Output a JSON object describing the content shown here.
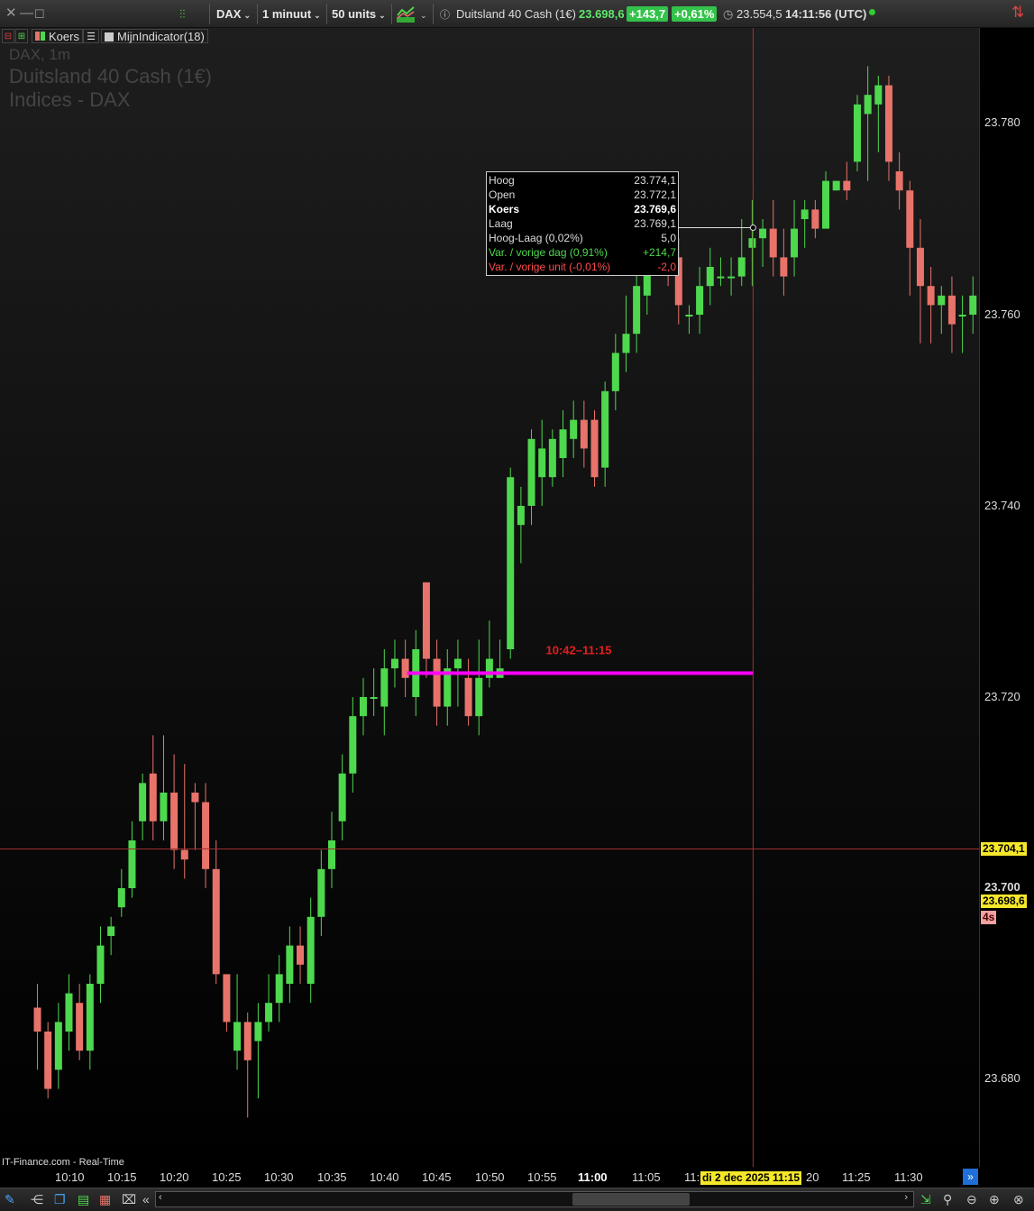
{
  "toolbar": {
    "instrument": "DAX",
    "timeframe": "1 minuut",
    "units": "50 units",
    "instrument_name": "Duitsland 40 Cash (1€)",
    "price": "23.698,6",
    "change_abs": "+143,7",
    "change_pct": "+0,61%",
    "prev_close": "23.554,5",
    "time": "14:11:56 (UTC)"
  },
  "legend": {
    "koers": "Koers",
    "indicator": "MijnIndicator(18)"
  },
  "watermark": {
    "line1": "DAX, 1m",
    "line2": "Duitsland 40 Cash (1€)",
    "line3": "Indices - DAX"
  },
  "tooltip": [
    {
      "label": "Hoog",
      "value": "23.774,1",
      "style": "normal"
    },
    {
      "label": "Open",
      "value": "23.772,1",
      "style": "normal"
    },
    {
      "label": "Koers",
      "value": "23.769,6",
      "style": "bold"
    },
    {
      "label": "Laag",
      "value": "23.769,1",
      "style": "normal"
    },
    {
      "label": "Hoog-Laag (0,02%)",
      "value": "5,0",
      "style": "normal"
    },
    {
      "label": "Var. / vorige dag (0,91%)",
      "value": "+214,7",
      "style": "green"
    },
    {
      "label": "Var. / vorige unit (-0,01%)",
      "value": "-2,0",
      "style": "red"
    }
  ],
  "price_axis": {
    "ticks": [
      "23.780",
      "23.760",
      "23.740",
      "23.720",
      "23.700",
      "23.680"
    ],
    "crosshair_price": "23.704,1",
    "last_price": "23.698,6",
    "countdown": "4s"
  },
  "time_axis": {
    "labels": [
      "10:10",
      "10:15",
      "10:20",
      "10:25",
      "10:30",
      "10:35",
      "10:40",
      "10:45",
      "10:50",
      "10:55",
      "11:00",
      "11:05",
      "11:",
      "20",
      "11:25",
      "11:30"
    ],
    "crosshair_time": "di 2 dec 2025 11:15"
  },
  "range_label": "10:42–11:15",
  "source": "IT-Finance.com - Real-Time",
  "colors": {
    "up": "#4ed84e",
    "down": "#e8736a",
    "magenta": "#ff00ff",
    "crosshair": "#a03030",
    "tag_yellow": "#f5e72a",
    "tag_pink": "#f4a0a0"
  },
  "chart_data": {
    "type": "candlestick",
    "title": "Duitsland 40 Cash (1€)",
    "xlabel": "",
    "ylabel": "",
    "ylim": [
      23670,
      23790
    ],
    "range_level": 23722.5,
    "range_start": "10:42",
    "range_end": "11:15",
    "candles": [
      [
        "10:07",
        23687.5,
        23685,
        23690,
        23681
      ],
      [
        "10:08",
        23685,
        23679,
        23686,
        23678
      ],
      [
        "10:09",
        23681,
        23686,
        23688,
        23679
      ],
      [
        "10:10",
        23685,
        23689,
        23691,
        23683
      ],
      [
        "10:11",
        23688,
        23683,
        23690,
        23682
      ],
      [
        "10:12",
        23683,
        23690,
        23691,
        23681
      ],
      [
        "10:13",
        23690,
        23694,
        23696,
        23688
      ],
      [
        "10:14",
        23695,
        23696,
        23697,
        23693
      ],
      [
        "10:15",
        23698,
        23700,
        23702,
        23697
      ],
      [
        "10:16",
        23700,
        23705,
        23707,
        23699
      ],
      [
        "10:17",
        23707,
        23711,
        23712,
        23705
      ],
      [
        "10:18",
        23712,
        23707,
        23716,
        23705
      ],
      [
        "10:19",
        23707,
        23710,
        23716,
        23705
      ],
      [
        "10:20",
        23710,
        23704,
        23714,
        23702
      ],
      [
        "10:21",
        23704,
        23703,
        23713,
        23701
      ],
      [
        "10:22",
        23710,
        23709,
        23711,
        23704
      ],
      [
        "10:23",
        23709,
        23702,
        23711,
        23700
      ],
      [
        "10:24",
        23702,
        23691,
        23705,
        23690
      ],
      [
        "10:25",
        23691,
        23686,
        23691,
        23685
      ],
      [
        "10:26",
        23683,
        23686,
        23691,
        23681
      ],
      [
        "10:27",
        23686,
        23682,
        23687,
        23676
      ],
      [
        "10:28",
        23684,
        23686,
        23688,
        23678
      ],
      [
        "10:29",
        23686,
        23688,
        23691,
        23685
      ],
      [
        "10:30",
        23688,
        23691,
        23693,
        23686
      ],
      [
        "10:31",
        23690,
        23694,
        23696,
        23688
      ],
      [
        "10:32",
        23694,
        23692,
        23696,
        23690
      ],
      [
        "10:33",
        23690,
        23697,
        23699,
        23688
      ],
      [
        "10:34",
        23697,
        23702,
        23704,
        23695
      ],
      [
        "10:35",
        23702,
        23705,
        23708,
        23700
      ],
      [
        "10:36",
        23707,
        23712,
        23714,
        23705
      ],
      [
        "10:37",
        23712,
        23718,
        23720,
        23710
      ],
      [
        "10:38",
        23718,
        23720,
        23722,
        23716
      ],
      [
        "10:39",
        23720,
        23720,
        23723,
        23718
      ],
      [
        "10:40",
        23719,
        23723,
        23725,
        23716
      ],
      [
        "10:41",
        23723,
        23724,
        23726,
        23721
      ],
      [
        "10:42",
        23724,
        23722,
        23726,
        23720
      ],
      [
        "10:43",
        23720,
        23725,
        23727,
        23718
      ],
      [
        "10:44",
        23732,
        23724,
        23732,
        23722
      ],
      [
        "10:45",
        23724,
        23719,
        23726,
        23717
      ],
      [
        "10:46",
        23719,
        23723,
        23725,
        23717
      ],
      [
        "10:47",
        23723,
        23724,
        23726,
        23719
      ],
      [
        "10:48",
        23722,
        23718,
        23724,
        23717
      ],
      [
        "10:49",
        23718,
        23722,
        23726,
        23716
      ],
      [
        "10:50",
        23722,
        23724,
        23728,
        23721
      ],
      [
        "10:51",
        23722,
        23723,
        23726,
        23722
      ],
      [
        "10:52",
        23725,
        23743,
        23744,
        23724
      ],
      [
        "10:53",
        23738,
        23740,
        23742,
        23734
      ],
      [
        "10:54",
        23740,
        23747,
        23748,
        23738
      ],
      [
        "10:55",
        23743,
        23746,
        23749,
        23740
      ],
      [
        "10:56",
        23743,
        23747,
        23748,
        23742
      ],
      [
        "10:57",
        23745,
        23748,
        23750,
        23743
      ],
      [
        "10:58",
        23747,
        23749,
        23751,
        23745
      ],
      [
        "10:59",
        23749,
        23746,
        23751,
        23744
      ],
      [
        "11:00",
        23749,
        23743,
        23750,
        23742
      ],
      [
        "11:01",
        23744,
        23752,
        23753,
        23742
      ],
      [
        "11:02",
        23752,
        23756,
        23758,
        23750
      ],
      [
        "11:03",
        23756,
        23758,
        23762,
        23754
      ],
      [
        "11:04",
        23758,
        23763,
        23765,
        23756
      ],
      [
        "11:05",
        23762,
        23770,
        23772,
        23760
      ],
      [
        "11:06",
        23770,
        23769,
        23774,
        23766
      ],
      [
        "11:07",
        23769,
        23768,
        23774,
        23763
      ],
      [
        "11:08",
        23766,
        23761,
        23768,
        23759
      ],
      [
        "11:09",
        23760,
        23760,
        23761,
        23758
      ],
      [
        "11:10",
        23760,
        23763,
        23765,
        23758
      ],
      [
        "11:11",
        23763,
        23765,
        23767,
        23761
      ],
      [
        "11:12",
        23764,
        23764,
        23766,
        23763
      ],
      [
        "11:13",
        23764,
        23764,
        23766,
        23762
      ],
      [
        "11:14",
        23764,
        23766,
        23770,
        23763
      ],
      [
        "11:15",
        23767,
        23768,
        23772,
        23763
      ],
      [
        "11:16",
        23768,
        23769,
        23770,
        23765
      ],
      [
        "11:17",
        23769,
        23766,
        23772,
        23764
      ],
      [
        "11:18",
        23766,
        23764,
        23769,
        23762
      ],
      [
        "11:19",
        23766,
        23769,
        23772,
        23764
      ],
      [
        "11:20",
        23770,
        23771,
        23772,
        23767
      ],
      [
        "11:21",
        23771,
        23769,
        23772,
        23768
      ],
      [
        "11:22",
        23769,
        23774,
        23775,
        23769
      ],
      [
        "11:23",
        23773,
        23774,
        23774,
        23773
      ],
      [
        "11:24",
        23774,
        23773,
        23776,
        23772
      ],
      [
        "11:25",
        23776,
        23782,
        23783,
        23775
      ],
      [
        "11:26",
        23781,
        23783,
        23786,
        23774
      ],
      [
        "11:27",
        23782,
        23784,
        23785,
        23777
      ],
      [
        "11:28",
        23784,
        23776,
        23785,
        23774
      ],
      [
        "11:29",
        23775,
        23773,
        23777,
        23771
      ],
      [
        "11:30",
        23773,
        23767,
        23774,
        23762
      ],
      [
        "11:31",
        23767,
        23763,
        23770,
        23757
      ],
      [
        "11:32",
        23763,
        23761,
        23765,
        23757
      ],
      [
        "11:33",
        23761,
        23762,
        23763,
        23758
      ],
      [
        "11:34",
        23762,
        23759,
        23764,
        23756
      ],
      [
        "11:35",
        23760,
        23760,
        23762,
        23756
      ],
      [
        "11:36",
        23760,
        23762,
        23764,
        23758
      ],
      [
        "11:37",
        23762,
        23767,
        23768,
        23760
      ],
      [
        "11:38",
        23767,
        23761,
        23769,
        23759
      ],
      [
        "11:39",
        23761,
        23768,
        23770,
        23760
      ],
      [
        "11:40",
        23767,
        23769,
        23771,
        23765
      ],
      [
        "11:41",
        23769,
        23766,
        23770,
        23764
      ],
      [
        "11:42",
        23766,
        23765,
        23767,
        23764
      ],
      [
        "11:43",
        23764,
        23751,
        23766,
        23750
      ]
    ]
  }
}
